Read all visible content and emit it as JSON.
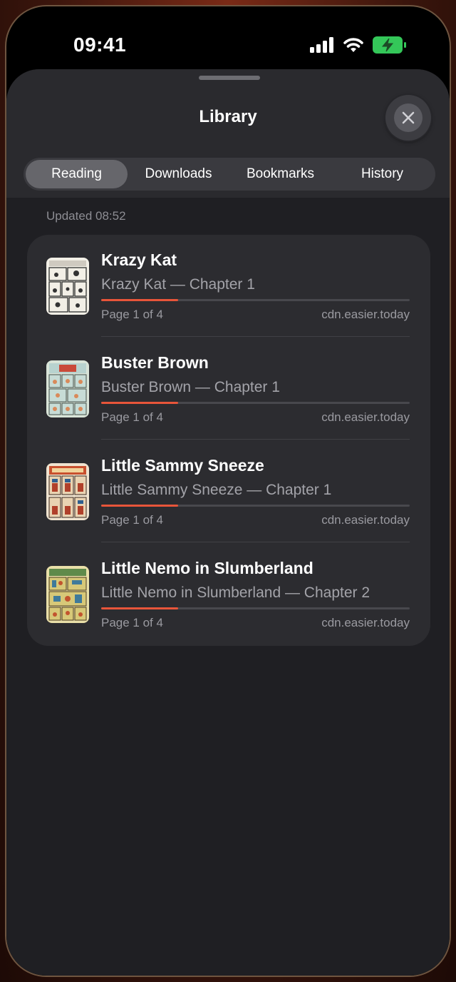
{
  "status_bar": {
    "time": "09:41",
    "battery_color": "#34c759",
    "icons": [
      "signal-icon",
      "wifi-icon",
      "battery-charging-icon"
    ]
  },
  "sheet": {
    "title": "Library",
    "close_icon": "close-icon"
  },
  "tabs": [
    {
      "label": "Reading",
      "active": true
    },
    {
      "label": "Downloads",
      "active": false
    },
    {
      "label": "Bookmarks",
      "active": false
    },
    {
      "label": "History",
      "active": false
    }
  ],
  "updated_text": "Updated 08:52",
  "accent_color": "#e8553a",
  "items": [
    {
      "title": "Krazy Kat",
      "subtitle": "Krazy Kat — Chapter 1",
      "page": "Page 1 of 4",
      "source": "cdn.easier.today",
      "progress": 0.25
    },
    {
      "title": "Buster Brown",
      "subtitle": "Buster Brown — Chapter 1",
      "page": "Page 1 of 4",
      "source": "cdn.easier.today",
      "progress": 0.25
    },
    {
      "title": "Little Sammy Sneeze",
      "subtitle": "Little Sammy Sneeze — Chapter 1",
      "page": "Page 1 of 4",
      "source": "cdn.easier.today",
      "progress": 0.25
    },
    {
      "title": "Little Nemo in Slumberland",
      "subtitle": "Little Nemo in Slumberland — Chapter 2",
      "page": "Page 1 of 4",
      "source": "cdn.easier.today",
      "progress": 0.25
    }
  ]
}
